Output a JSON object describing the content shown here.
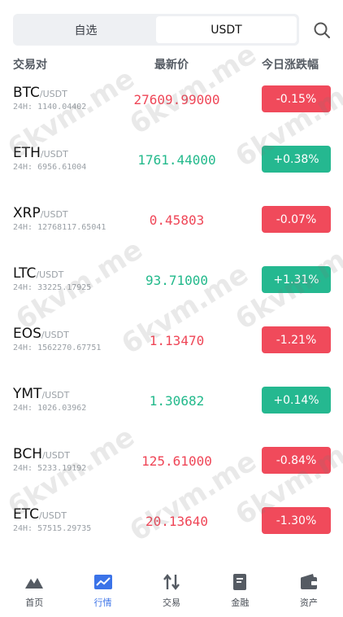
{
  "segments": [
    {
      "label": "自选",
      "active": false
    },
    {
      "label": "USDT",
      "active": true
    }
  ],
  "columns": {
    "pair": "交易对",
    "price": "最新价",
    "change": "今日涨跌幅"
  },
  "rows": [
    {
      "base": "BTC",
      "quote": "/USDT",
      "volume": "24H: 1140.04402",
      "price": "27609.99000",
      "change": "-0.15%",
      "direction": "down"
    },
    {
      "base": "ETH",
      "quote": "/USDT",
      "volume": "24H: 6956.61004",
      "price": "1761.44000",
      "change": "+0.38%",
      "direction": "up"
    },
    {
      "base": "XRP",
      "quote": "/USDT",
      "volume": "24H: 12768117.65041",
      "price": "0.45803",
      "change": "-0.07%",
      "direction": "down"
    },
    {
      "base": "LTC",
      "quote": "/USDT",
      "volume": "24H: 33225.17925",
      "price": "93.71000",
      "change": "+1.31%",
      "direction": "up"
    },
    {
      "base": "EOS",
      "quote": "/USDT",
      "volume": "24H: 1562270.67751",
      "price": "1.13470",
      "change": "-1.21%",
      "direction": "down"
    },
    {
      "base": "YMT",
      "quote": "/USDT",
      "volume": "24H: 1026.03962",
      "price": "1.30682",
      "change": "+0.14%",
      "direction": "up"
    },
    {
      "base": "BCH",
      "quote": "/USDT",
      "volume": "24H: 5233.19192",
      "price": "125.61000",
      "change": "-0.84%",
      "direction": "down"
    },
    {
      "base": "ETC",
      "quote": "/USDT",
      "volume": "24H: 57515.29735",
      "price": "20.13640",
      "change": "-1.30%",
      "direction": "down"
    }
  ],
  "watermark": "6kvm.me",
  "tabs": [
    {
      "label": "首页",
      "icon": "mountain-icon",
      "active": false
    },
    {
      "label": "行情",
      "icon": "chart-icon",
      "active": true
    },
    {
      "label": "交易",
      "icon": "swap-arrows-icon",
      "active": false
    },
    {
      "label": "金融",
      "icon": "document-icon",
      "active": false
    },
    {
      "label": "资产",
      "icon": "wallet-icon",
      "active": false
    }
  ],
  "colors": {
    "up": "#25b890",
    "down": "#f04a5b",
    "accent": "#3b73e8"
  }
}
